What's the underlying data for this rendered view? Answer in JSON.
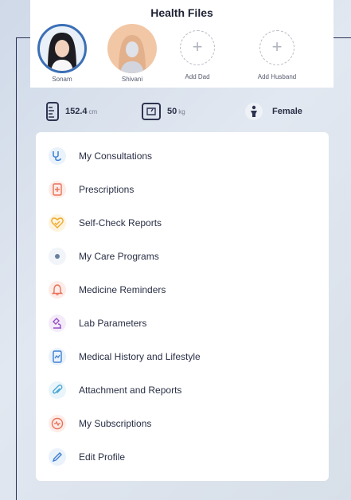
{
  "header": {
    "title": "Health Files"
  },
  "profiles": [
    {
      "name": "Sonam",
      "selected": true
    },
    {
      "name": "Shivani",
      "selected": false
    },
    {
      "name": "Add Dad",
      "add": true
    },
    {
      "name": "Add Husband",
      "add": true
    }
  ],
  "stats": {
    "height": {
      "value": "152.4",
      "unit": "cm"
    },
    "weight": {
      "value": "50",
      "unit": "kg"
    },
    "gender": {
      "value": "Female"
    }
  },
  "menu": {
    "items": [
      {
        "label": "My Consultations",
        "icon": "stethoscope-icon",
        "color": "#3d7fd1"
      },
      {
        "label": "Prescriptions",
        "icon": "prescription-icon",
        "color": "#e8715a"
      },
      {
        "label": "Self-Check Reports",
        "icon": "heart-check-icon",
        "color": "#f0a92a"
      },
      {
        "label": "My Care Programs",
        "icon": "care-program-icon",
        "color": "#6a7fa0"
      },
      {
        "label": "Medicine Reminders",
        "icon": "bell-icon",
        "color": "#e8715a"
      },
      {
        "label": "Lab Parameters",
        "icon": "microscope-icon",
        "color": "#9a4fc5"
      },
      {
        "label": "Medical History and Lifestyle",
        "icon": "chart-file-icon",
        "color": "#3d7fd1"
      },
      {
        "label": "Attachment and Reports",
        "icon": "paperclip-icon",
        "color": "#4aa7d6"
      },
      {
        "label": "My Subscriptions",
        "icon": "subscription-icon",
        "color": "#e8715a"
      },
      {
        "label": "Edit Profile",
        "icon": "pencil-icon",
        "color": "#3d7fd1"
      }
    ]
  },
  "colors": {
    "accent": "#3b6fb6",
    "frame": "#2b2f55"
  }
}
